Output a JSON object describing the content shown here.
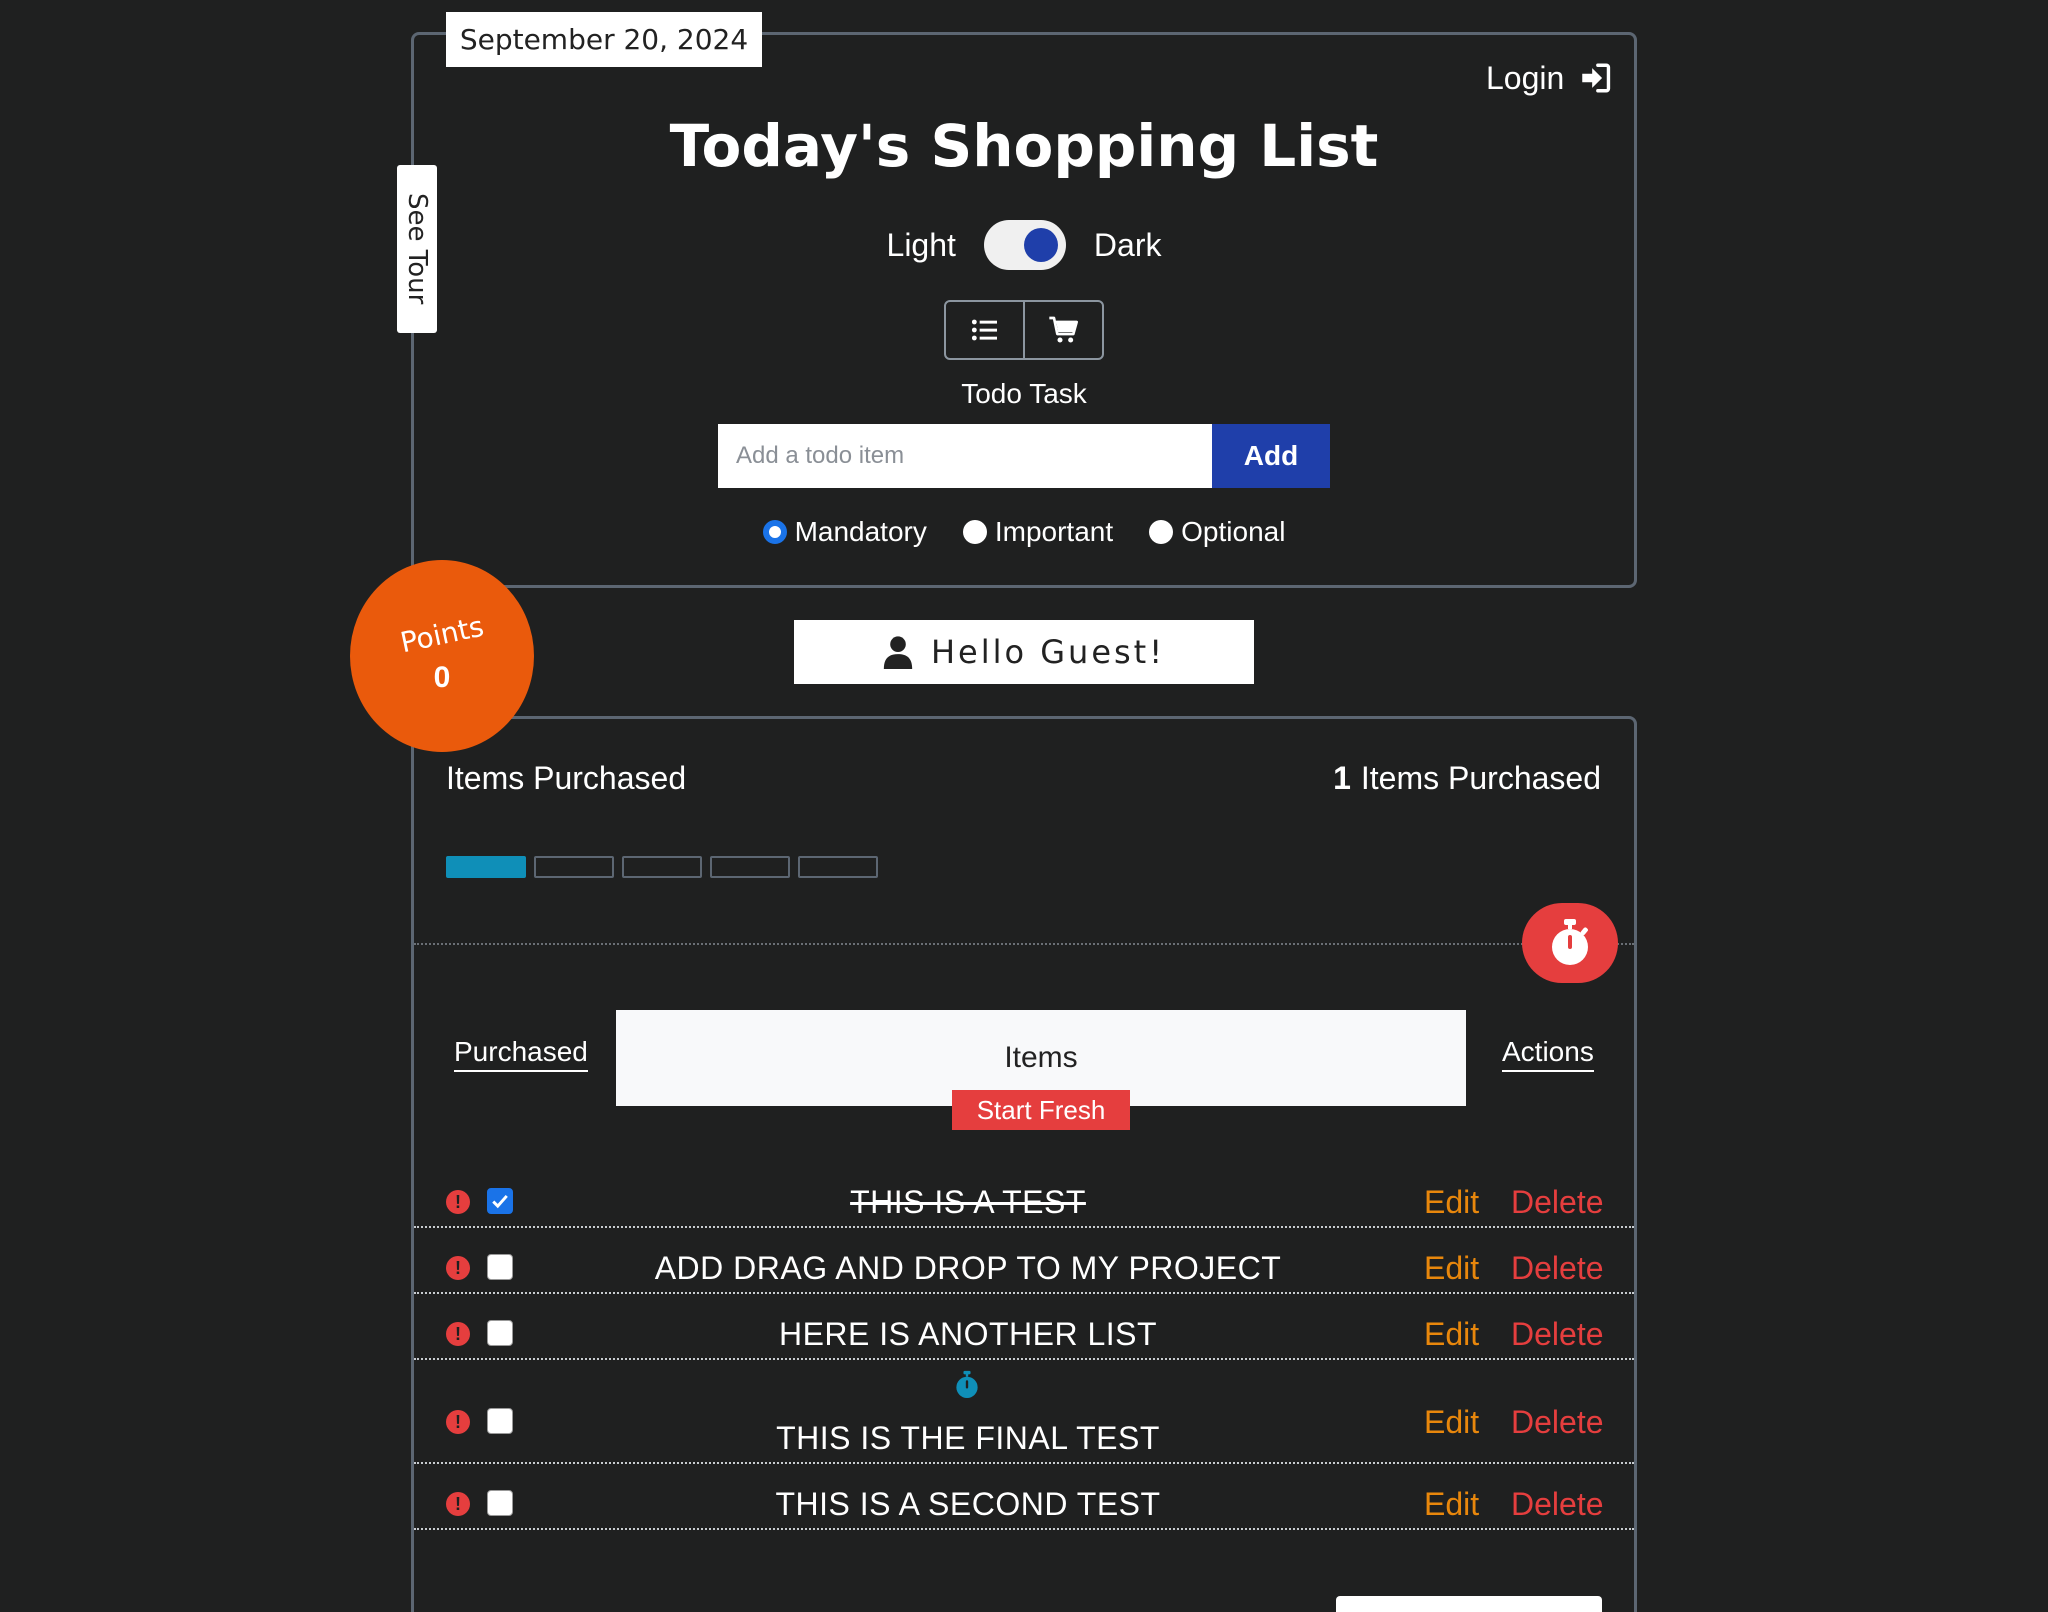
{
  "date_tab": "September 20, 2024",
  "header": {
    "login_label": "Login",
    "title": "Today's Shopping List"
  },
  "theme": {
    "light_label": "Light",
    "dark_label": "Dark",
    "dark_enabled": true
  },
  "view_toggle": {
    "list_icon": "list-icon",
    "cart_icon": "cart-icon"
  },
  "todo": {
    "section_label": "Todo Task",
    "input_placeholder": "Add a todo item",
    "input_value": "",
    "add_label": "Add",
    "priorities": [
      {
        "label": "Mandatory",
        "checked": true
      },
      {
        "label": "Important",
        "checked": false
      },
      {
        "label": "Optional",
        "checked": false
      }
    ]
  },
  "see_tour_label": "See Tour",
  "points": {
    "label": "Points",
    "value": "0"
  },
  "greeting": "Hello Guest!",
  "purchased": {
    "left_label": "Items Purchased",
    "count": "1",
    "right_label": "Items Purchased",
    "progress_filled": 1,
    "progress_total": 5
  },
  "table": {
    "col_purchased": "Purchased",
    "col_items": "Items",
    "col_actions": "Actions",
    "start_fresh": "Start Fresh",
    "edit_label": "Edit",
    "delete_label": "Delete",
    "rows": [
      {
        "text": "THIS IS A TEST",
        "checked": true,
        "timer": false
      },
      {
        "text": "ADD DRAG AND DROP TO MY PROJECT",
        "checked": false,
        "timer": false
      },
      {
        "text": "HERE IS ANOTHER LIST",
        "checked": false,
        "timer": false
      },
      {
        "text": "THIS IS THE FINAL TEST",
        "checked": false,
        "timer": true
      },
      {
        "text": "THIS IS A SECOND TEST",
        "checked": false,
        "timer": false
      }
    ]
  },
  "colors": {
    "background": "#1f2020",
    "accent_blue": "#1f3faa",
    "points_orange": "#ea5a0c",
    "danger_red": "#e53e3e",
    "edit_orange": "#e8870c",
    "progress_teal": "#0f8fb8"
  }
}
